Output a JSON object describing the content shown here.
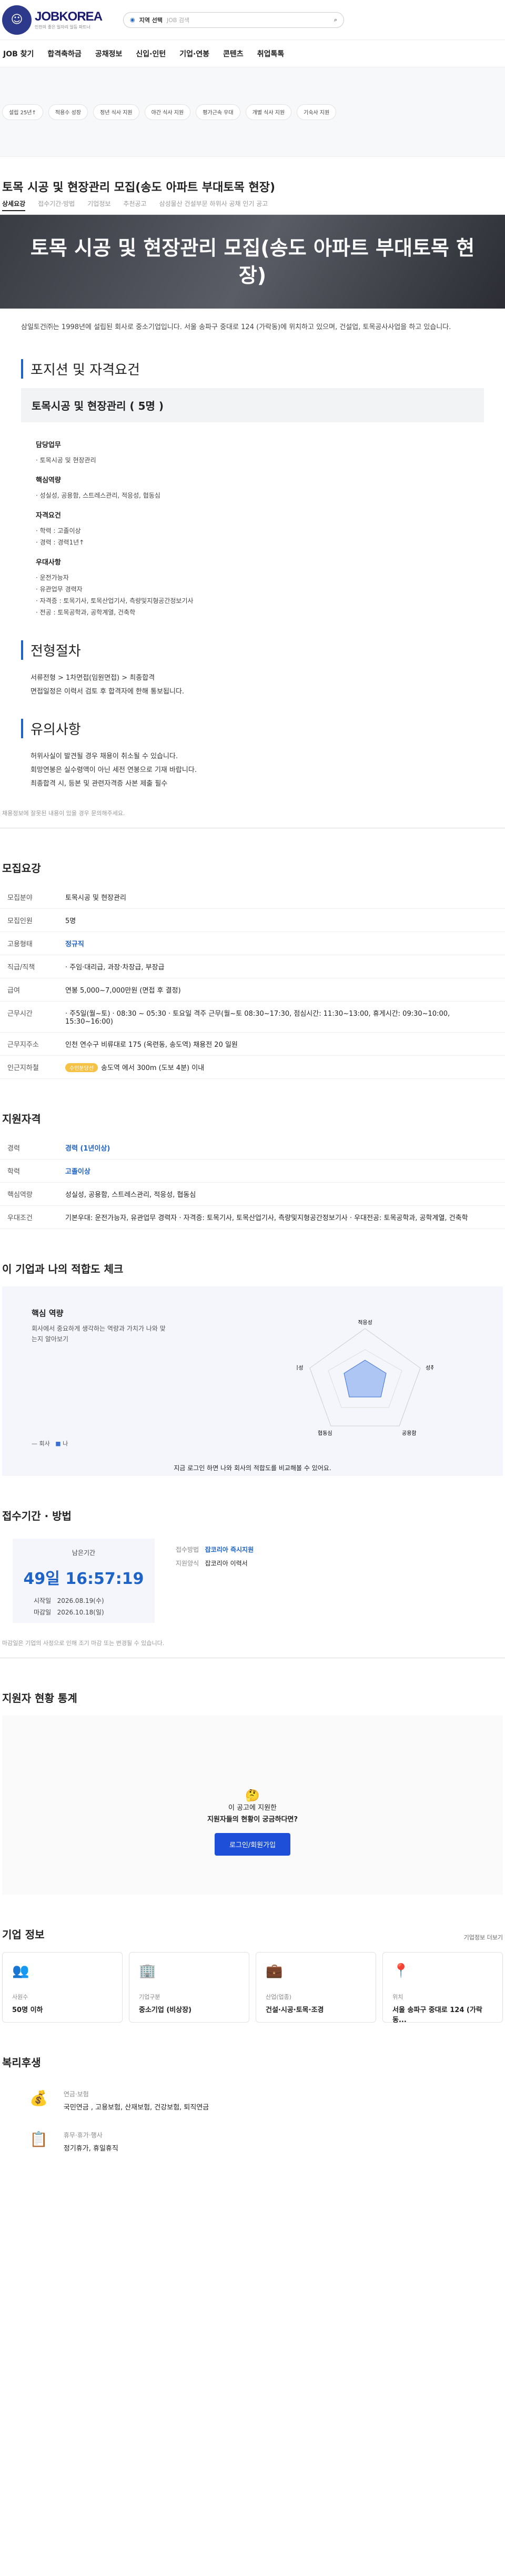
{
  "header": {
    "logo": "JOBKOREA",
    "tagline": "인천의 좋은 일자리 일등 파트너",
    "location": "지역 선택",
    "search_placeholder": "JOB 검색"
  },
  "nav": [
    "JOB 찾기",
    "합격축하금",
    "공채정보",
    "신입·인턴",
    "기업·연봉",
    "콘텐츠",
    "취업톡톡"
  ],
  "chips": [
    "설립 25년↑",
    "적용수 성장",
    "정년 식사 지원",
    "야간 식사 지원",
    "평가근속 우대",
    "개별 식사 지원",
    "기숙사 지원"
  ],
  "title": "토목 시공 및 현장관리 모집(송도 아파트 부대토목 현장)",
  "tabs": [
    "상세요강",
    "접수기간·방법",
    "기업정보",
    "추천공고",
    "삼성물산 건설부문 하위사 공채 인기 공고"
  ],
  "hero": "토목 시공 및 현장관리 모집(송도 아파트 부대토목 현장)",
  "intro": "삼일토건㈜는 1998년에 설립된 회사로 중소기업입니다. 서울 송파구 중대로 124 (가락동)에 위치하고 있으며, 건설업, 토목공사사업을 하고 있습니다.",
  "section1": {
    "heading": "포지션 및 자격요건",
    "position": "토목시공 및 현장관리 ( 5명 )",
    "blocks": [
      {
        "h": "담당업무",
        "lines": [
          "· 토목시공 및 현장관리"
        ]
      },
      {
        "h": "핵심역량",
        "lines": [
          "· 성실성, 공용함, 스트레스관리, 적응성, 협동심"
        ]
      },
      {
        "h": "자격요건",
        "lines": [
          "· 학력 : 고졸이상",
          "· 경력 : 경력1년↑"
        ]
      },
      {
        "h": "우대사항",
        "lines": [
          "· 운전가능자",
          "· 유관업무 경력자",
          "· 자격증 : 토목기사, 토목산업기사, 측량및지형공간정보기사",
          "· 전공 : 토목공학과, 공학계열, 건축학"
        ]
      }
    ]
  },
  "section2": {
    "heading": "전형절차",
    "lines": [
      "서류전형 > 1차면접(임원면접) > 최종합격",
      "면접일정은 이력서 검토 후 합격자에 한해 통보됩니다."
    ]
  },
  "section3": {
    "heading": "유의사항",
    "lines": [
      "허위사실이 발견될 경우 채용이 취소될 수 있습니다.",
      "회망연봉은 실수령액이 아닌 세전 연봉으로 기재 바랍니다.",
      "최종합격 시, 등본 및 관련자격증 사본 제출 필수"
    ]
  },
  "note1": "채용정보에 잘못된 내용이 있을 경우 문의해주세요.",
  "summary": {
    "heading": "모집요강",
    "rows": [
      {
        "k": "모집분야",
        "v": "토목시공 및 현장관리"
      },
      {
        "k": "모집인원",
        "v": "5명"
      },
      {
        "k": "고용형태",
        "v": "정규직"
      },
      {
        "k": "직급/직책",
        "v": "· 주임·대리급, 과장·차장급, 부장급"
      },
      {
        "k": "급여",
        "v": "연봉 5,000~7,000만원 (면접 후 결정)"
      },
      {
        "k": "근무시간",
        "v": "· 주5일(월~토) · 08:30 ~ 05:30 · 토요일 격주 근무(월~토 08:30~17:30, 점심시간: 11:30~13:00, 휴게시간: 09:30~10:00, 15:30~16:00)"
      },
      {
        "k": "근무지주소",
        "v": "인천 연수구 비류대로 175 (옥련동, 송도역) 채용전 20 일원"
      },
      {
        "k": "인근지하철",
        "v": "송도역 에서 300m (도보 4분) 이내",
        "pill": "수인분당선"
      }
    ]
  },
  "qual": {
    "heading": "지원자격",
    "rows": [
      {
        "k": "경력",
        "v": "경력 (1년이상)"
      },
      {
        "k": "학력",
        "v": "고졸이상"
      },
      {
        "k": "핵심역량",
        "v": "성실성, 공용함, 스트레스관리, 적응성, 협동심"
      },
      {
        "k": "우대조건",
        "v": "기본우대: 운전가능자, 유관업무 경력자 · 자격증: 토목기사, 토목산업기사, 측량및지형공간정보기사 · 우대전공: 토목공학과, 공학계열, 건축학"
      }
    ]
  },
  "fit": {
    "heading": "이 기업과 나의 적합도 체크",
    "box_title": "핵심 역량",
    "desc": "회사에서 중요하게 생각하는 역량과 가치가 나와 맞는지 알아보기",
    "axes": [
      "적응성",
      "성취지향성",
      "공용함",
      "협동심",
      "적응성"
    ],
    "legend_company": "회사",
    "legend_me": "나",
    "footer": "지금 로그인 하면 나와 회사의 적합도를 비교해볼 수 있어요."
  },
  "deadline": {
    "heading": "접수기간 · 방법",
    "left_label": "남은기간",
    "countdown": "49일 16:57:19",
    "start_label": "시작일",
    "start": "2026.08.19(수)",
    "end_label": "마감일",
    "end": "2026.10.18(일)",
    "method_label": "접수방법",
    "method": "잡코리아 즉시지원",
    "form_label": "지원양식",
    "form": "잡코리아 이력서"
  },
  "note2": "마감일은 기업의 사정으로 인해 조기 마감 또는 변경될 수 있습니다.",
  "stats": {
    "heading": "지원자 현황 통계",
    "q1": "이 공고에 지원한",
    "q2": "지원자들의 현황이 궁금하다면?",
    "button": "로그인/회원가입"
  },
  "company": {
    "heading": "기업 정보",
    "more": "기업정보 더보기",
    "cards": [
      {
        "icon": "👥",
        "l": "사원수",
        "v": "50명 이하"
      },
      {
        "icon": "🏢",
        "l": "기업구분",
        "v": "중소기업 (비상장)"
      },
      {
        "icon": "💼",
        "l": "산업(업종)",
        "v": "건설·시공·토목·조경"
      },
      {
        "icon": "📍",
        "l": "위치",
        "v": "서울 송파구 중대로 124 (가락동..."
      }
    ]
  },
  "welfare": {
    "heading": "복리후생",
    "items": [
      {
        "icon": "💰",
        "t": "연금·보험",
        "v": "국민연금 , 고용보험, 산재보험, 건강보험, 퇴직연금"
      },
      {
        "icon": "📋",
        "t": "휴무·휴가·행사",
        "v": "정기휴가, 휴일휴직"
      }
    ]
  }
}
